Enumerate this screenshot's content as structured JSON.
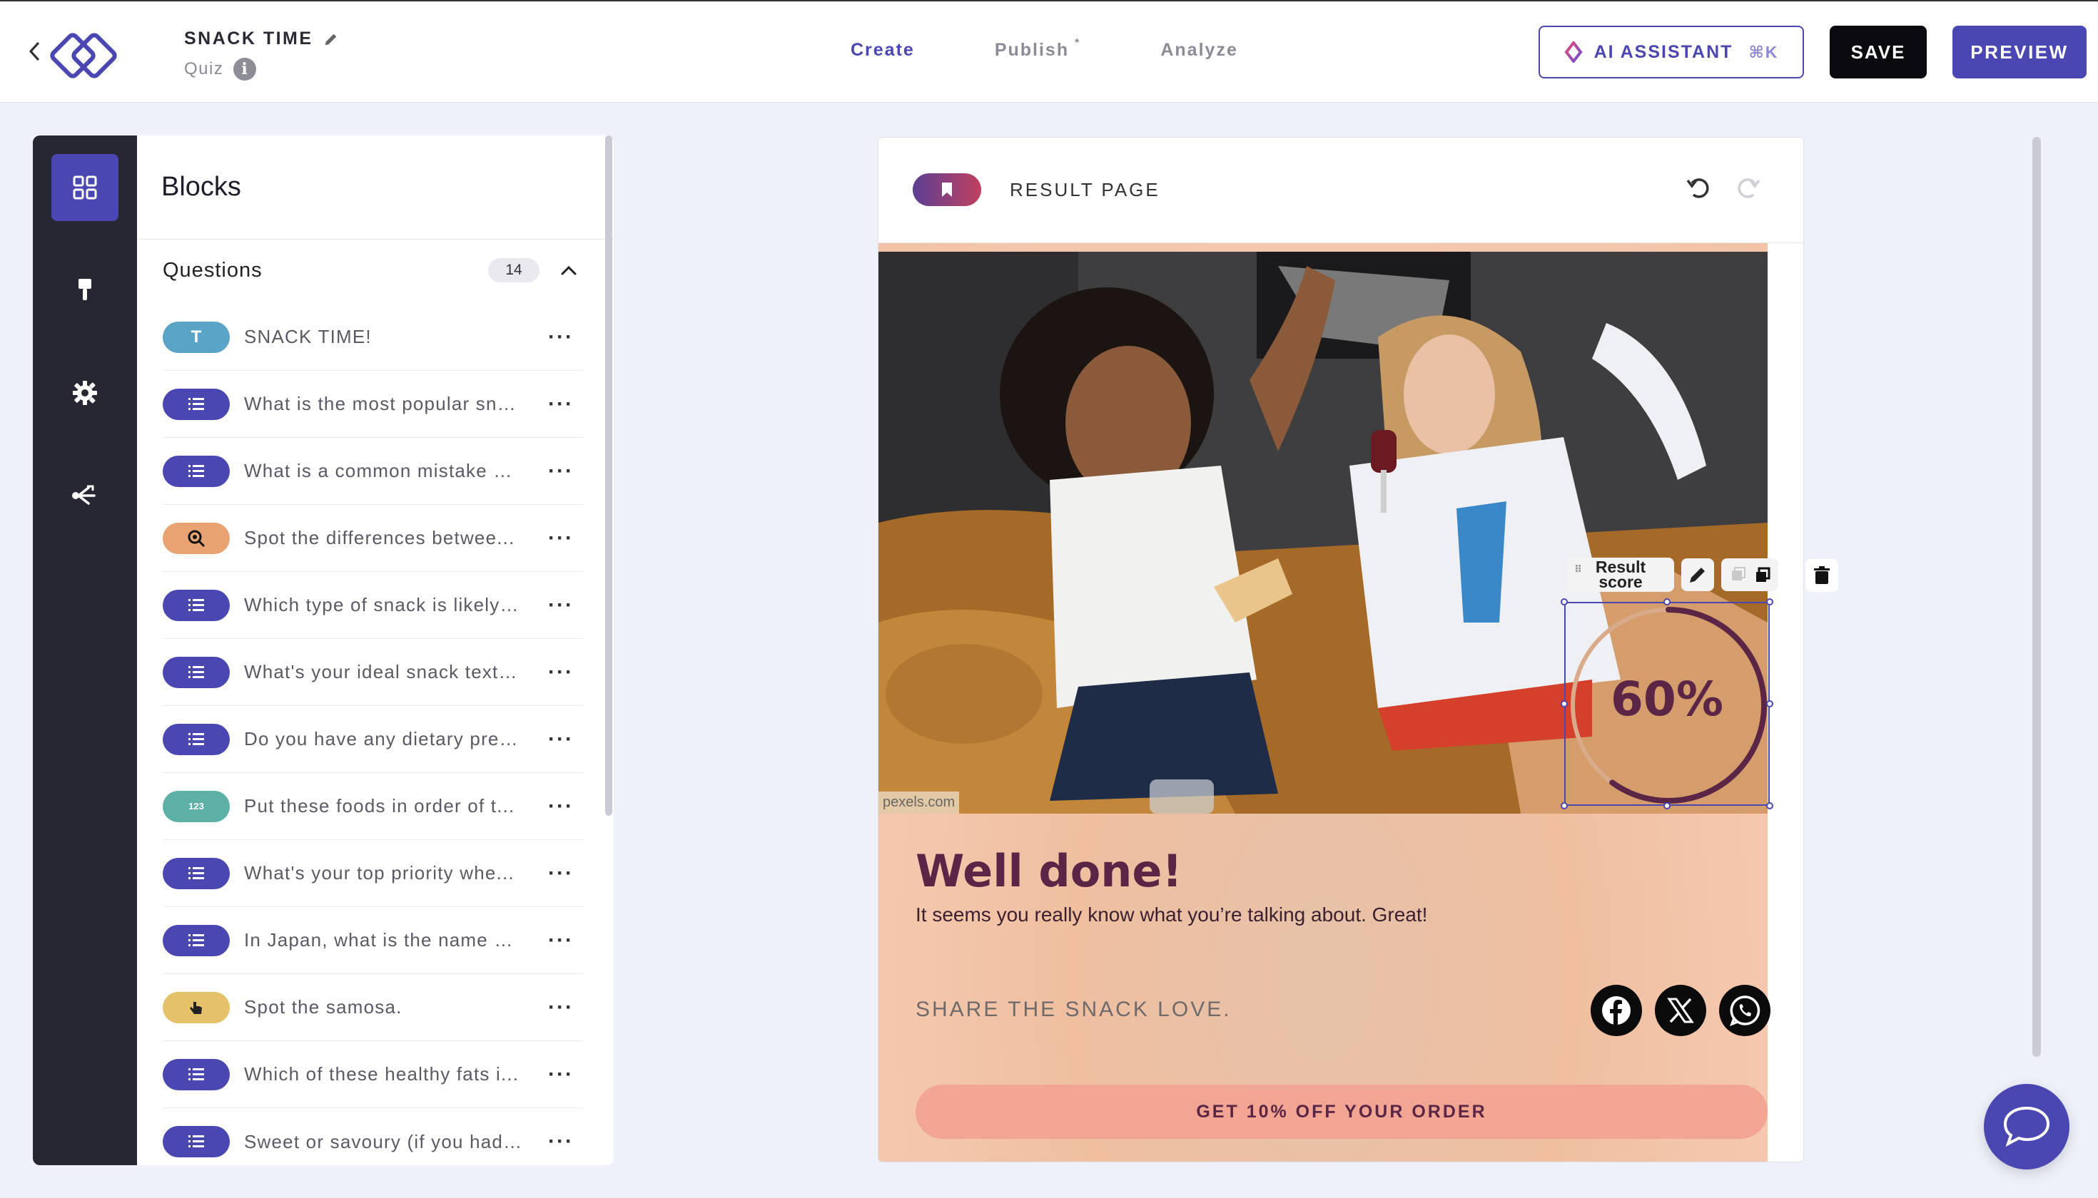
{
  "header": {
    "title": "SNACK TIME",
    "subtitle": "Quiz",
    "tabs": [
      {
        "label": "Create"
      },
      {
        "label": "Publish",
        "dot": "*"
      },
      {
        "label": "Analyze"
      }
    ],
    "ai_label": "AI ASSISTANT",
    "ai_shortcut": "⌘K",
    "save_label": "SAVE",
    "preview_label": "PREVIEW"
  },
  "blocks": {
    "title": "Blocks",
    "section_title": "Questions",
    "count": "14",
    "items": [
      {
        "badge": "T",
        "type": "text",
        "label": "SNACK TIME!"
      },
      {
        "badge": "list",
        "type": "list",
        "label": "What is the most popular sna..."
      },
      {
        "badge": "list",
        "type": "list",
        "label": "What is a common mistake p..."
      },
      {
        "badge": "zoom",
        "type": "spot",
        "label": "Spot the differences betwee..."
      },
      {
        "badge": "list",
        "type": "list",
        "label": "Which type of snack is likely ..."
      },
      {
        "badge": "list",
        "type": "list",
        "label": "What's your ideal snack textu..."
      },
      {
        "badge": "list",
        "type": "list",
        "label": "Do you have any dietary pref..."
      },
      {
        "badge": "123",
        "type": "order",
        "label": "Put these foods in order of t..."
      },
      {
        "badge": "list",
        "type": "list",
        "label": "What's your top priority whe..."
      },
      {
        "badge": "list",
        "type": "list",
        "label": "In Japan, what is the name o..."
      },
      {
        "badge": "hand",
        "type": "pointer",
        "label": "Spot the samosa."
      },
      {
        "badge": "list",
        "type": "list",
        "label": "Which of these healthy fats i..."
      },
      {
        "badge": "list",
        "type": "list",
        "label": "Sweet or savoury (if you had ..."
      }
    ],
    "more": "···"
  },
  "canvas": {
    "page_label": "RESULT PAGE",
    "photo_credit": "pexels.com",
    "score_chip": "Result score",
    "score_value": 0.6,
    "score_text": "60%",
    "headline": "Well done!",
    "subtext": "It seems you really know what you’re talking about. Great!",
    "share_label": "SHARE THE SNACK LOVE.",
    "share_icons": [
      "facebook-icon",
      "x-icon",
      "whatsapp-icon"
    ],
    "cta_label": "GET 10% OFF YOUR ORDER"
  },
  "colors": {
    "accent": "#4b47b2",
    "headline": "#5b2546",
    "badge_list": "#4b47b2",
    "badge_text": "#5aa4c8",
    "badge_spot": "#e9a373",
    "badge_order": "#5cb0a6",
    "badge_pointer": "#e5c26a",
    "cta": "#f1a592"
  }
}
